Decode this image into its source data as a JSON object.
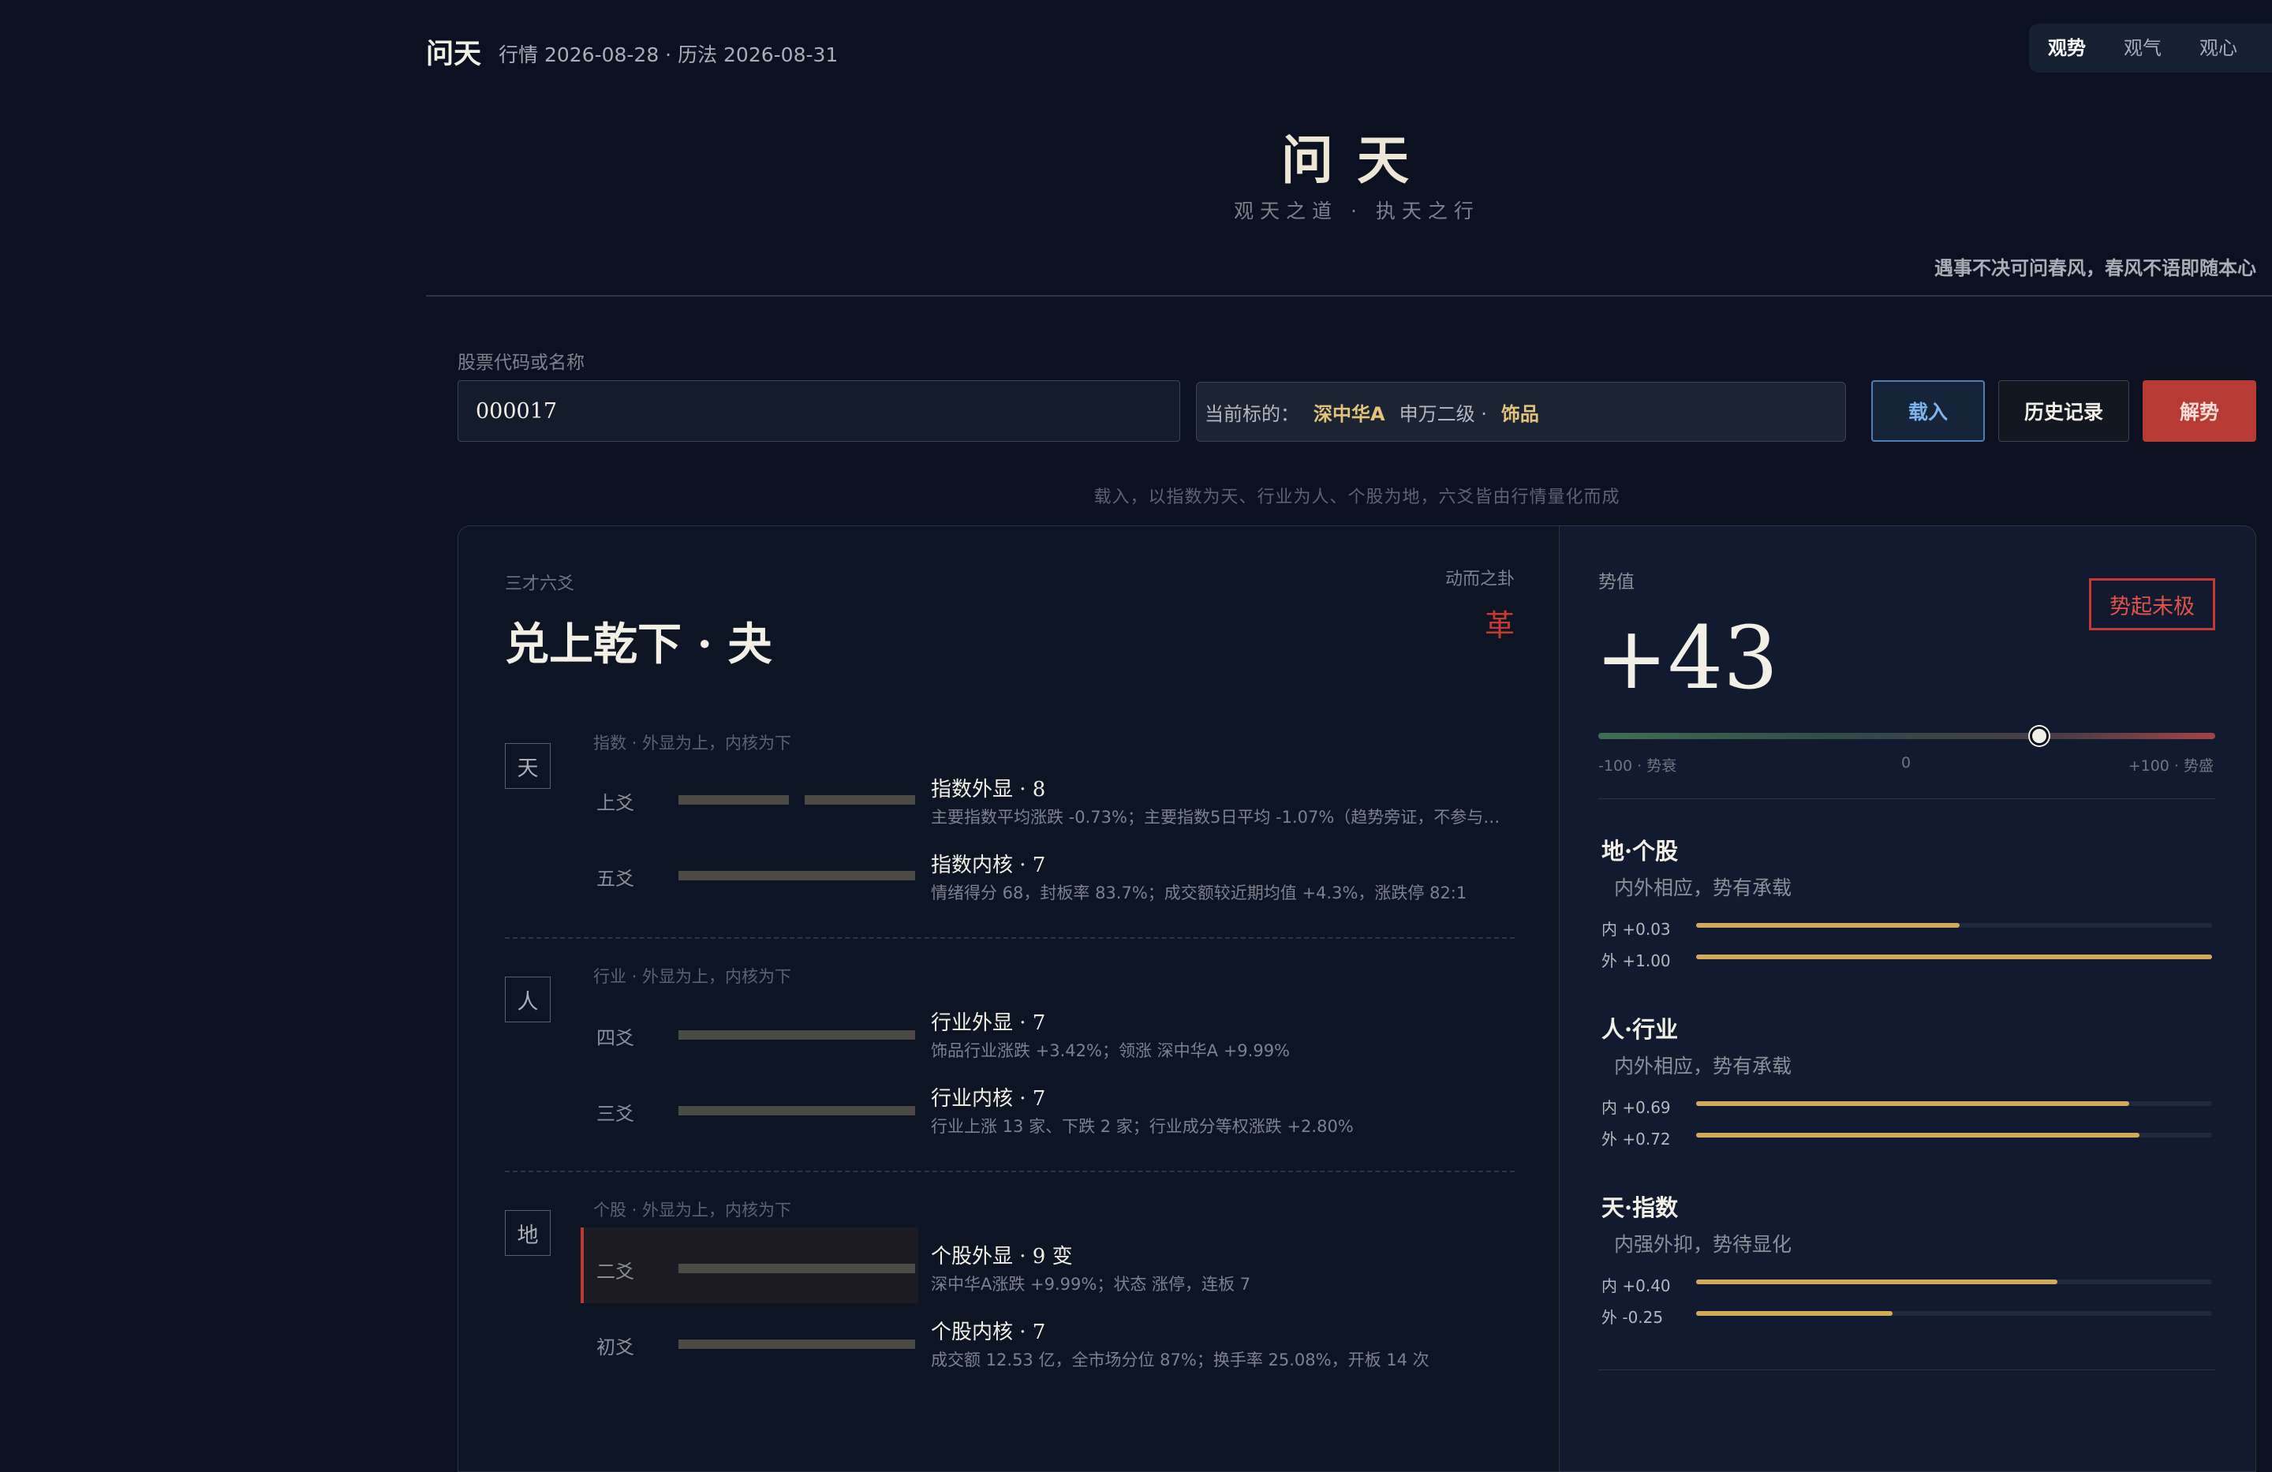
{
  "header": {
    "brand": "问天",
    "dates": "行情 2026-08-28 · 历法 2026-08-31",
    "tabs": [
      {
        "label": "观势",
        "active": true
      },
      {
        "label": "观气",
        "active": false
      },
      {
        "label": "观心",
        "active": false
      }
    ]
  },
  "hero": {
    "title": "问天",
    "subtitle": "观天之道 · 执天之行",
    "motto": "遇事不决可问春风，春风不语即随本心"
  },
  "search": {
    "label": "股票代码或名称",
    "value": "000017",
    "target_prefix": "当前标的：",
    "target_name": "深中华A",
    "target_industry_prefix": "申万二级 ·",
    "target_industry": "饰品",
    "load_label": "载入",
    "history_label": "历史记录",
    "solve_label": "解势",
    "hint": "载入，以指数为天、行业为人、个股为地，六爻皆由行情量化而成"
  },
  "hexagram": {
    "section_label": "三才六爻",
    "name": "兑上乾下 · 夬",
    "moving_label": "动而之卦",
    "moving_gua": "革",
    "tiers": [
      {
        "tag": "天",
        "desc": "指数 · 外显为上，内核为下",
        "lines": [
          {
            "name": "上爻",
            "yin": true,
            "title": "指数外显 · 8",
            "detail": "主要指数平均涨跌 -0.73%；主要指数5日平均 -1.07%（趋势旁证，不参与外显计分）"
          },
          {
            "name": "五爻",
            "yin": false,
            "title": "指数内核 · 7",
            "detail": "情绪得分 68，封板率 83.7%；成交额较近期均值 +4.3%，涨跌停 82:1"
          }
        ]
      },
      {
        "tag": "人",
        "desc": "行业 · 外显为上，内核为下",
        "lines": [
          {
            "name": "四爻",
            "yin": false,
            "title": "行业外显 · 7",
            "detail": "饰品行业涨跌 +3.42%；领涨 深中华A +9.99%"
          },
          {
            "name": "三爻",
            "yin": false,
            "title": "行业内核 · 7",
            "detail": "行业上涨 13 家、下跌 2 家；行业成分等权涨跌 +2.80%"
          }
        ]
      },
      {
        "tag": "地",
        "desc": "个股 · 外显为上，内核为下",
        "lines": [
          {
            "name": "二爻",
            "yin": false,
            "title": "个股外显 · 9 变",
            "detail": "深中华A涨跌 +9.99%；状态 涨停，连板 7"
          },
          {
            "name": "初爻",
            "yin": false,
            "title": "个股内核 · 7",
            "detail": "成交额 12.53 亿，全市场分位 87%；换手率 25.08%，开板 14 次"
          }
        ]
      }
    ]
  },
  "momentum": {
    "label": "势值",
    "value": "+43",
    "value_num": 43,
    "badge": "势起未极",
    "scale_min_label": "-100 · 势衰",
    "scale_mid_label": "0",
    "scale_max_label": "+100 · 势盛",
    "tiers": [
      {
        "title": "地·个股",
        "sub": "内外相应，势有承载",
        "inner_label": "内 +0.03",
        "inner_pct": 51,
        "outer_label": "外 +1.00",
        "outer_pct": 100
      },
      {
        "title": "人·行业",
        "sub": "内外相应，势有承载",
        "inner_label": "内 +0.69",
        "inner_pct": 84,
        "outer_label": "外 +0.72",
        "outer_pct": 86
      },
      {
        "title": "天·指数",
        "sub": "内强外抑，势待显化",
        "inner_label": "内 +0.40",
        "inner_pct": 70,
        "outer_label": "外 -0.25",
        "outer_pct": 38
      }
    ]
  },
  "colors": {
    "background": "#0b1120",
    "accent_red": "#b83a34",
    "gold": "#e3c27a",
    "meter_gold": "#d3aa5b",
    "load_blue": "#4f7eb5"
  }
}
